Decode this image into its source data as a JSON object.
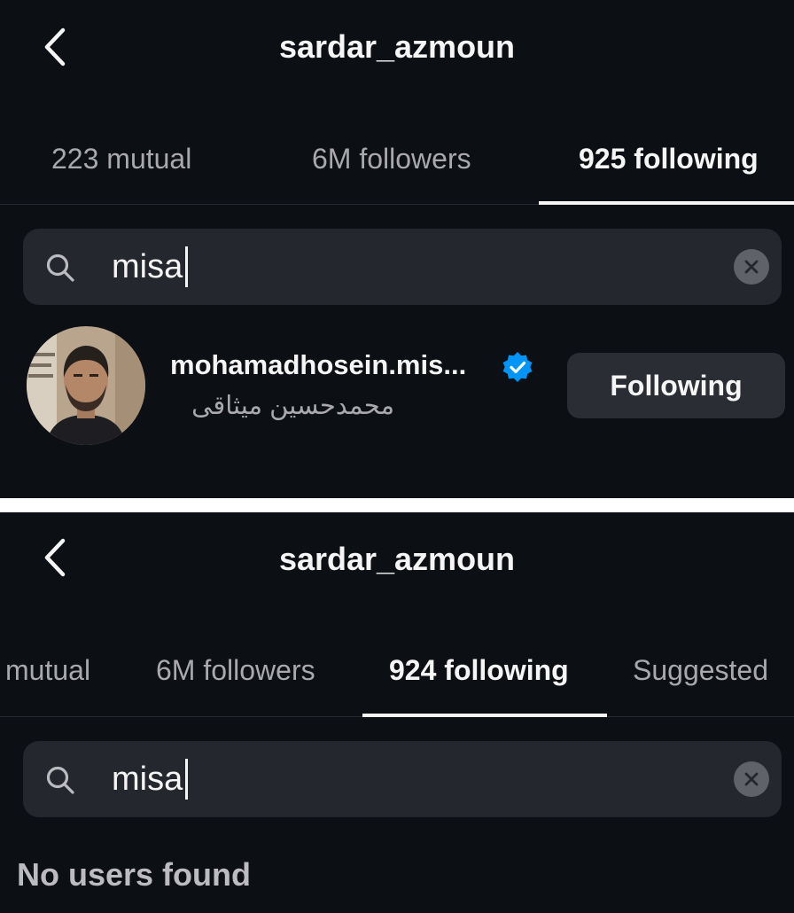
{
  "top_panel": {
    "header": {
      "title": "sardar_azmoun"
    },
    "tabs": [
      {
        "label": "223 mutual",
        "active": false
      },
      {
        "label": "6M followers",
        "active": false
      },
      {
        "label": "925 following",
        "active": true
      }
    ],
    "search": {
      "value": "misa"
    },
    "results": [
      {
        "username": "mohamadhosein.mis...",
        "full_name": "محمدحسين ميثاقى",
        "verified": true,
        "button_label": "Following"
      }
    ]
  },
  "bottom_panel": {
    "header": {
      "title": "sardar_azmoun"
    },
    "tabs": [
      {
        "label": "mutual",
        "active": false
      },
      {
        "label": "6M followers",
        "active": false
      },
      {
        "label": "924 following",
        "active": true
      },
      {
        "label": "Suggested",
        "active": false
      }
    ],
    "search": {
      "value": "misa"
    },
    "empty_state": "No users found"
  },
  "icons": {
    "back": "chevron-left-icon",
    "search": "magnifier-icon",
    "clear": "circle-x-icon",
    "verified": "blue-check-badge-icon"
  },
  "colors": {
    "background": "#0c0f14",
    "search_background": "#24272d",
    "button_background": "#2a2d33",
    "verified_blue": "#0095f6",
    "active_text": "#f5f5f5",
    "inactive_text": "#a8a8ad"
  }
}
